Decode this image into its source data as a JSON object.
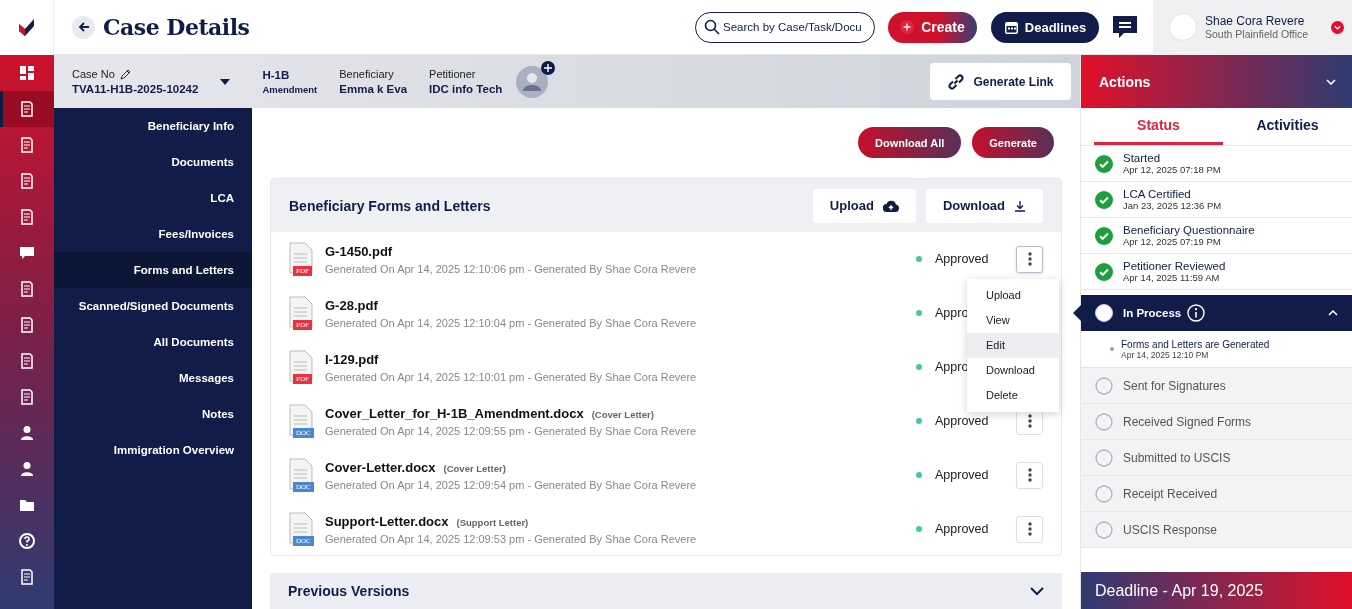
{
  "header": {
    "title": "Case Details",
    "search": {
      "placeholder": "Search by Case/Task/Docu"
    },
    "create_button": "Create",
    "deadlines_button": "Deadlines",
    "user": {
      "name": "Shae Cora Revere",
      "office": "South Plainfield Office"
    }
  },
  "rail": [
    {
      "selected": false
    },
    {
      "selected": true
    },
    {
      "selected": false
    },
    {
      "selected": false
    },
    {
      "selected": false
    },
    {
      "selected": false
    },
    {
      "selected": false
    },
    {
      "selected": false
    },
    {
      "selected": false
    },
    {
      "selected": false
    },
    {
      "selected": false
    },
    {
      "selected": false
    },
    {
      "selected": false
    },
    {
      "selected": false
    },
    {
      "selected": false
    }
  ],
  "case_bar": {
    "case_no_label": "Case No",
    "case_no": "TVA11-H1B-2025-10242",
    "visa": "H-1B",
    "visa_type": "Amendment",
    "beneficiary_label": "Beneficiary",
    "beneficiary": "Emma k Eva",
    "petitioner_label": "Petitioner",
    "petitioner": "IDC info Tech",
    "generate_link": "Generate Link"
  },
  "nav": [
    {
      "label": "Beneficiary Info",
      "selected": false
    },
    {
      "label": "Documents",
      "selected": false
    },
    {
      "label": "LCA",
      "selected": false
    },
    {
      "label": "Fees/Invoices",
      "selected": false
    },
    {
      "label": "Forms and Letters",
      "selected": true
    },
    {
      "label": "Scanned/Signed Documents",
      "selected": false
    },
    {
      "label": "All Documents",
      "selected": false
    },
    {
      "label": "Messages",
      "selected": false
    },
    {
      "label": "Notes",
      "selected": false
    },
    {
      "label": "Immigration Overview",
      "selected": false
    }
  ],
  "toolbar": {
    "download_all": "Download All",
    "generate": "Generate"
  },
  "forms_card": {
    "title": "Beneficiary Forms and Letters",
    "upload": "Upload",
    "download": "Download",
    "documents": [
      {
        "kind": "pdf",
        "badge": "PDF",
        "name": "G-1450.pdf",
        "meta": "Generated On Apr 14, 2025 12:10:06 pm - Generated By Shae Cora Revere",
        "status": "Approved",
        "menu_open": true
      },
      {
        "kind": "pdf",
        "badge": "PDF",
        "name": "G-28.pdf",
        "meta": "Generated On Apr 14, 2025 12:10:04 pm - Generated By Shae Cora Revere",
        "status": "Appro",
        "menu_open": false
      },
      {
        "kind": "pdf",
        "badge": "PDF",
        "name": "I-129.pdf",
        "meta": "Generated On Apr 14, 2025 12:10:01 pm - Generated By Shae Cora Revere",
        "status": "Appro",
        "menu_open": false
      },
      {
        "kind": "doc",
        "badge": "DOC",
        "name": "Cover_Letter_for_H-1B_Amendment.docx",
        "tag": "(Cover Letter)",
        "meta": "Generated On Apr 14, 2025 12:09:55 pm - Generated By Shae Cora Revere",
        "status": "Approved",
        "menu_open": false
      },
      {
        "kind": "doc",
        "badge": "DOC",
        "name": "Cover-Letter.docx",
        "tag": "(Cover Letter)",
        "meta": "Generated On Apr 14, 2025 12:09:54 pm - Generated By Shae Cora Revere",
        "status": "Approved",
        "menu_open": false
      },
      {
        "kind": "doc",
        "badge": "DOC",
        "name": "Support-Letter.docx",
        "tag": "(Support Letter)",
        "meta": "Generated On Apr 14, 2025 12:09:53 pm - Generated By Shae Cora Revere",
        "status": "Approved",
        "menu_open": false
      }
    ],
    "menu": [
      {
        "label": "Upload",
        "selected": false
      },
      {
        "label": "View",
        "selected": false
      },
      {
        "label": "Edit",
        "selected": true
      },
      {
        "label": "Download",
        "selected": false
      },
      {
        "label": "Delete",
        "selected": false
      }
    ]
  },
  "previous_versions": {
    "title": "Previous Versions",
    "expanded": false
  },
  "actions": {
    "title": "Actions",
    "expanded": true,
    "tabs": [
      {
        "label": "Status",
        "selected": true
      },
      {
        "label": "Activities",
        "selected": false
      }
    ],
    "steps": [
      {
        "kind": "done",
        "label": "Started",
        "date": "Apr 12, 2025 07:18 PM"
      },
      {
        "kind": "done",
        "label": "LCA Certified",
        "date": "Jan 23, 2025 12:36 PM"
      },
      {
        "kind": "done",
        "label": "Beneficiary Questionnaire",
        "date": "Apr 12, 2025 07:19 PM"
      },
      {
        "kind": "done",
        "label": "Petitioner Reviewed",
        "date": "Apr 14, 2025 11:59 AM"
      },
      {
        "kind": "active",
        "label": "In Process",
        "expanded": true,
        "substeps": [
          {
            "label": "Forms and Letters are Generated",
            "date": "Apr 14, 2025 12:10 PM"
          }
        ]
      },
      {
        "kind": "pending",
        "label": "Sent for Signatures"
      },
      {
        "kind": "pending",
        "label": "Received Signed Forms"
      },
      {
        "kind": "pending",
        "label": "Submitted to USCIS"
      },
      {
        "kind": "pending",
        "label": "Receipt Received"
      },
      {
        "kind": "pending",
        "label": "USCIS Response"
      }
    ],
    "deadline": "Deadline - Apr 19, 2025"
  }
}
